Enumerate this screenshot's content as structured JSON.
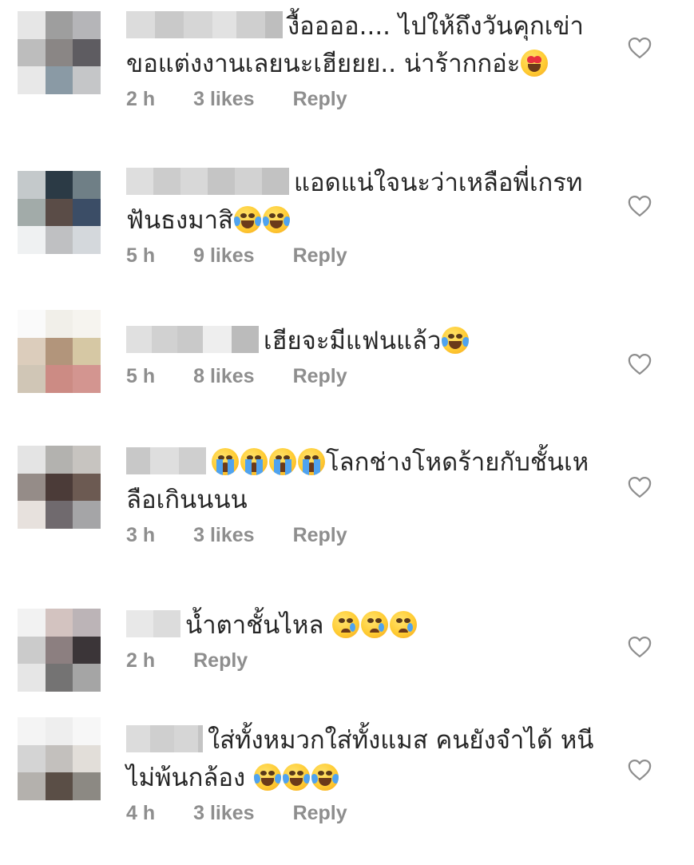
{
  "comments": [
    {
      "text": "งื้ออออ.... ไปให้ถึงวันคุกเข่าขอแต่งงานเลยนะเฮียยย.. น่าร้ากกอ่ะ",
      "emoji_icons": [
        "heart-eyes-emoji-icon"
      ],
      "time": "2 h",
      "likes": "3 likes",
      "reply": "Reply",
      "avatar_colors": [
        "#e6e6e6",
        "#9e9e9e",
        "#b5b5b8",
        "#bdbdbd",
        "#8a8685",
        "#5e5c61",
        "#e8e8e8",
        "#8a9aa5",
        "#c5c6c8"
      ],
      "name_blur_colors": [
        "#dcdcdc",
        "#c9c9c9",
        "#d6d6d6",
        "#e2e2e2",
        "#cfcfcf",
        "#bebebe"
      ]
    },
    {
      "text": "แอดแน่ใจนะว่าเหลือพี่เกรทฟันธงมาสิ",
      "emoji_icons": [
        "joy-emoji-icon",
        "joy-emoji-icon"
      ],
      "time": "5 h",
      "likes": "9 likes",
      "reply": "Reply",
      "avatar_colors": [
        "#c4c9cb",
        "#2b3a45",
        "#6f7f86",
        "#a2aba9",
        "#5a4c47",
        "#3b4d66",
        "#eff1f2",
        "#bfc0c2",
        "#d4d8dc"
      ],
      "name_blur_colors": [
        "#dedede",
        "#cccccc",
        "#d8d8d8",
        "#c5c5c5",
        "#d2d2d2",
        "#c2c2c2"
      ]
    },
    {
      "text": "เฮียจะมีแฟนแล้ว",
      "emoji_icons": [
        "joy-emoji-icon"
      ],
      "time": "5 h",
      "likes": "8 likes",
      "reply": "Reply",
      "avatar_colors": [
        "#fafafa",
        "#f1efe9",
        "#f6f4ef",
        "#dccdbc",
        "#b2957b",
        "#d6c8a4",
        "#d0c6b6",
        "#cc8b84",
        "#d39590"
      ],
      "name_blur_colors": [
        "#e0e0e0",
        "#d1d1d1",
        "#c9c9c9",
        "#eeeeee",
        "#bbbbbb"
      ]
    },
    {
      "text": "โลกช่างโหดร้ายกับชั้นเหลือเกินนนน",
      "emoji_icons": [
        "sob-emoji-icon",
        "sob-emoji-icon",
        "sob-emoji-icon",
        "sob-emoji-icon"
      ],
      "time": "3 h",
      "likes": "3 likes",
      "reply": "Reply",
      "avatar_colors": [
        "#e4e4e4",
        "#b3b2af",
        "#c7c4c0",
        "#958c88",
        "#4b3b38",
        "#6c5a52",
        "#e7e1dd",
        "#706a6e",
        "#a5a5a7"
      ],
      "name_blur_colors": [
        "#c8c8c8",
        "#dedede",
        "#cfcfcf"
      ]
    },
    {
      "text": "น้ำตาชั้นไหล",
      "emoji_icons": [
        "crying-emoji-icon",
        "crying-emoji-icon",
        "crying-emoji-icon"
      ],
      "time": "2 h",
      "likes": "",
      "reply": "Reply",
      "avatar_colors": [
        "#f2f2f2",
        "#d3c3c0",
        "#bcb4b7",
        "#cbcbcb",
        "#8c7f80",
        "#3b3538",
        "#e6e6e6",
        "#747373",
        "#a5a5a5"
      ],
      "name_blur_colors": [
        "#e8e8e8",
        "#dcdcdc"
      ]
    },
    {
      "text": "ใส่ทั้งหมวกใส่ทั้งแมส คนยังจำได้ หนีไม่พ้นกล้อง",
      "emoji_icons": [
        "joy-emoji-icon",
        "joy-emoji-icon",
        "joy-emoji-icon"
      ],
      "time": "4 h",
      "likes": "3 likes",
      "reply": "Reply",
      "avatar_colors": [
        "#f4f4f4",
        "#eeeeee",
        "#f7f7f7",
        "#d4d4d4",
        "#c3c0bd",
        "#e2ded9",
        "#b4b1ad",
        "#5a4e46",
        "#8c8983"
      ],
      "name_blur_colors": [
        "#dcdcdc",
        "#cfcfcf",
        "#d6d6d6",
        "#c4c4c4"
      ]
    }
  ]
}
